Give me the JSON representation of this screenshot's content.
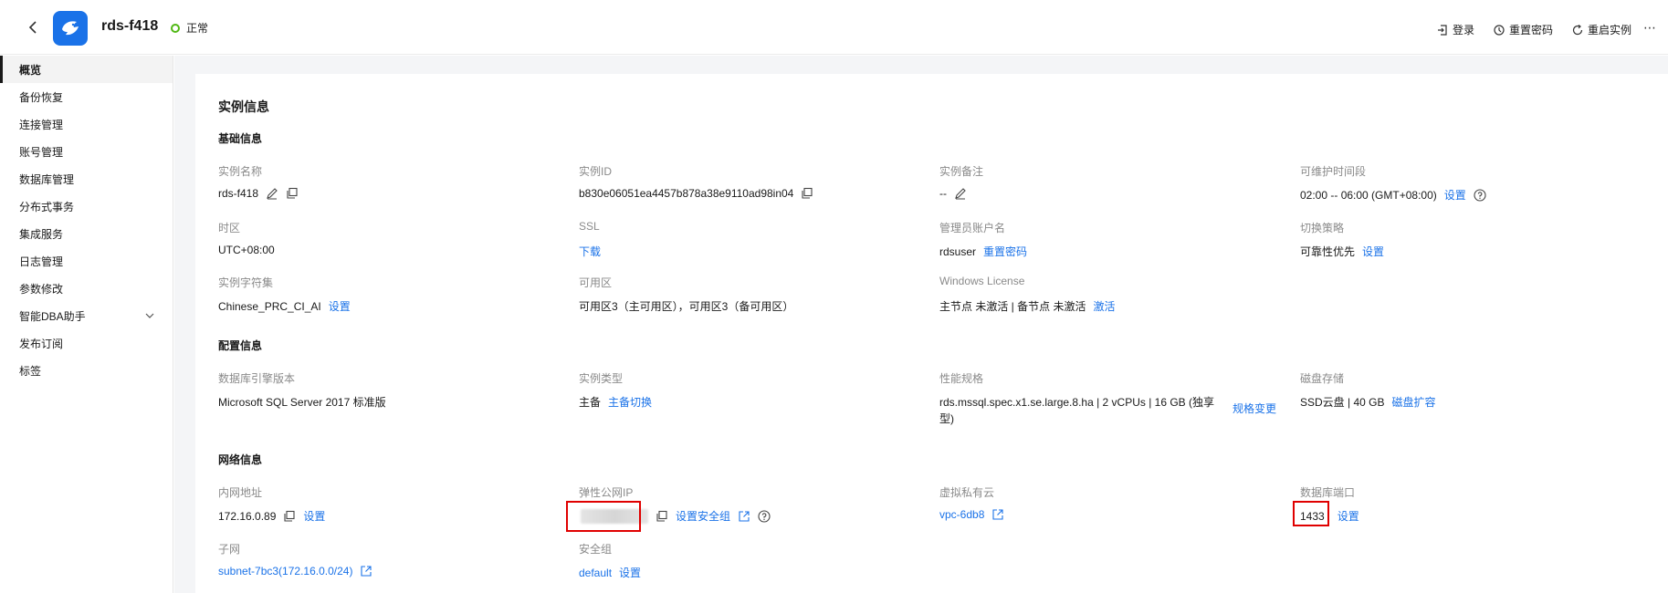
{
  "header": {
    "title": "rds-f418",
    "status": "正常",
    "status_color": "#50b814",
    "brand_color": "#1a72e8",
    "actions": [
      {
        "label": "登录",
        "icon": "login-icon"
      },
      {
        "label": "重置密码",
        "icon": "reset-password-icon"
      },
      {
        "label": "重启实例",
        "icon": "restart-icon"
      }
    ],
    "more": "⋯"
  },
  "sidebar": {
    "items": [
      {
        "label": "概览",
        "active": true
      },
      {
        "label": "备份恢复"
      },
      {
        "label": "连接管理"
      },
      {
        "label": "账号管理"
      },
      {
        "label": "数据库管理"
      },
      {
        "label": "分布式事务"
      },
      {
        "label": "集成服务"
      },
      {
        "label": "日志管理"
      },
      {
        "label": "参数修改"
      },
      {
        "label": "智能DBA助手",
        "expandable": true
      },
      {
        "label": "发布订阅"
      },
      {
        "label": "标签"
      }
    ]
  },
  "main": {
    "title": "实例信息",
    "basic": {
      "title": "基础信息",
      "instance_name": {
        "label": "实例名称",
        "value": "rds-f418"
      },
      "instance_id": {
        "label": "实例ID",
        "value": "b830e06051ea4457b878a38e9110ad98in04"
      },
      "instance_remark": {
        "label": "实例备注",
        "value": "--"
      },
      "maint_window": {
        "label": "可维护时间段",
        "value": "02:00 -- 06:00 (GMT+08:00)",
        "link": "设置"
      },
      "timezone": {
        "label": "时区",
        "value": "UTC+08:00"
      },
      "ssl": {
        "label": "SSL",
        "link": "下载"
      },
      "admin_user": {
        "label": "管理员账户名",
        "value": "rdsuser",
        "link": "重置密码"
      },
      "switch_policy": {
        "label": "切换策略",
        "value": "可靠性优先",
        "link": "设置"
      },
      "charset": {
        "label": "实例字符集",
        "value": "Chinese_PRC_CI_AI",
        "link": "设置"
      },
      "az": {
        "label": "可用区",
        "value": "可用区3（主可用区），可用区3（备可用区）"
      },
      "win_license": {
        "label": "Windows License",
        "value": "主节点 未激活 | 备节点 未激活",
        "link": "激活"
      }
    },
    "config": {
      "title": "配置信息",
      "engine": {
        "label": "数据库引擎版本",
        "value": "Microsoft SQL Server 2017 标准版"
      },
      "type": {
        "label": "实例类型",
        "value": "主备",
        "link": "主备切换"
      },
      "flavor": {
        "label": "性能规格",
        "value": "rds.mssql.spec.x1.se.large.8.ha | 2 vCPUs | 16 GB (独享型)",
        "link": "规格变更"
      },
      "storage": {
        "label": "磁盘存储",
        "value": "SSD云盘 | 40 GB",
        "link": "磁盘扩容"
      }
    },
    "network": {
      "title": "网络信息",
      "private_ip": {
        "label": "内网地址",
        "value": "172.16.0.89",
        "link": "设置"
      },
      "eip": {
        "label": "弹性公网IP",
        "link": "设置安全组"
      },
      "vpc": {
        "label": "虚拟私有云",
        "link": "vpc-6db8"
      },
      "port": {
        "label": "数据库端口",
        "value": "1433",
        "link": "设置"
      },
      "subnet": {
        "label": "子网",
        "link": "subnet-7bc3(172.16.0.0/24)"
      },
      "sec_group": {
        "label": "安全组",
        "value_link": "default",
        "link": "设置"
      }
    }
  }
}
